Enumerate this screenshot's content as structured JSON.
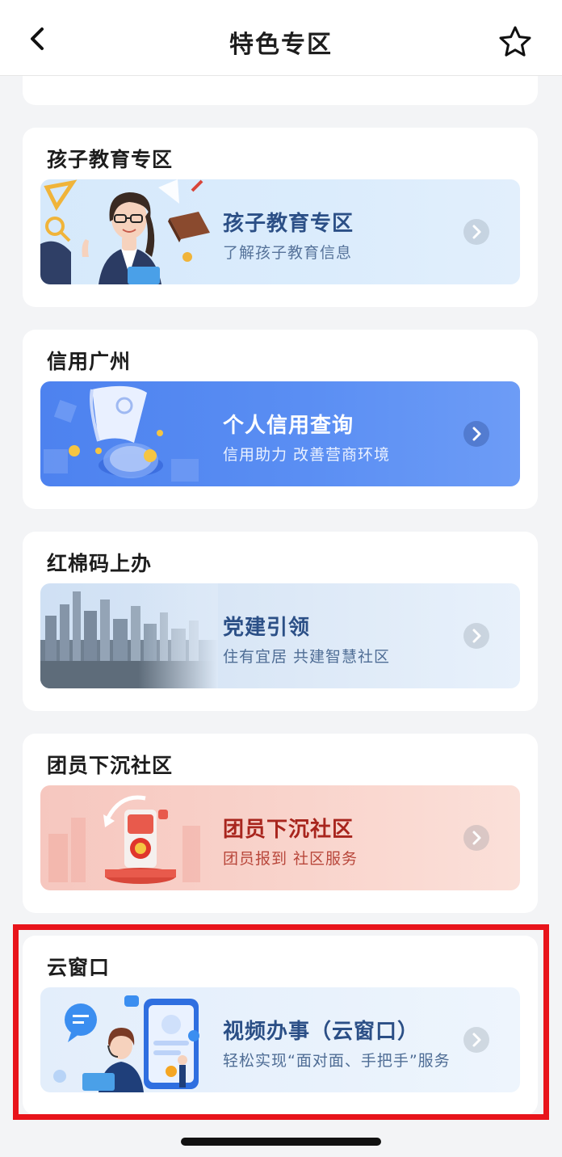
{
  "header": {
    "title": "特色专区",
    "back_icon": "back-chevron-icon",
    "favorite_icon": "star-outline-icon"
  },
  "sections": [
    {
      "title": "孩子教育专区",
      "banner_title": "孩子教育专区",
      "banner_subtitle": "了解孩子教育信息"
    },
    {
      "title": "信用广州",
      "banner_title": "个人信用查询",
      "banner_subtitle": "信用助力  改善营商环境"
    },
    {
      "title": "红棉码上办",
      "banner_title": "党建引领",
      "banner_subtitle": "住有宜居  共建智慧社区"
    },
    {
      "title": "团员下沉社区",
      "banner_title": "团员下沉社区",
      "banner_subtitle": "团员报到 社区服务"
    },
    {
      "title": "云窗口",
      "banner_title": "视频办事（云窗口）",
      "banner_subtitle": "轻松实现“面对面、手把手”服务"
    }
  ],
  "colors": {
    "highlight_border": "#e8141b",
    "page_background": "#f3f4f6"
  }
}
